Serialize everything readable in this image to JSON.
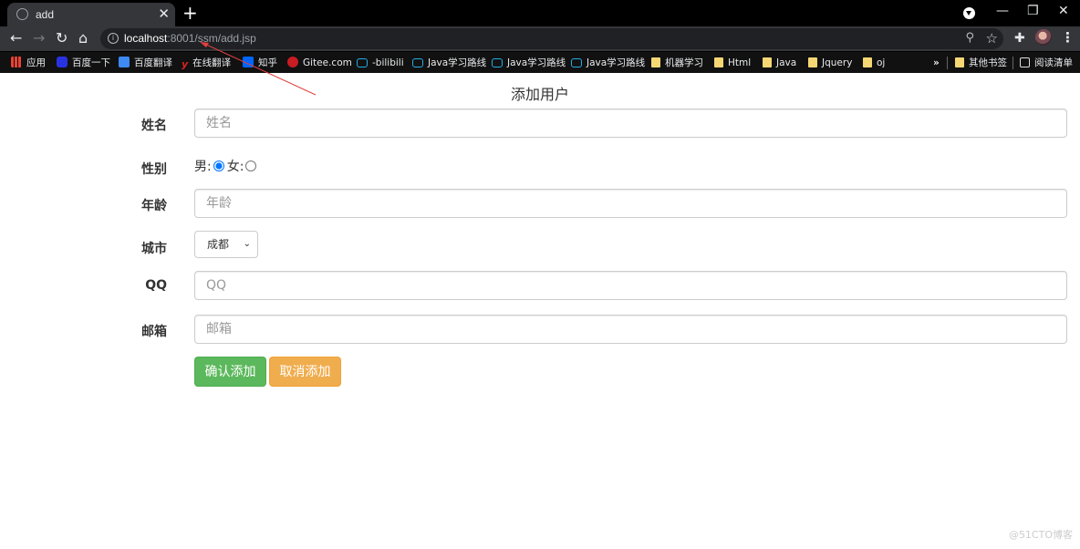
{
  "browser": {
    "tab_title": "add",
    "url_host": "localhost",
    "url_path": ":8001/ssm/add.jsp",
    "bookmarks": [
      "应用",
      "百度一下",
      "百度翻译",
      "在线翻译",
      "知乎",
      "Gitee.com",
      "-bilibili",
      "Java学习路线",
      "Java学习路线",
      "Java学习路线",
      "机器学习",
      "Html",
      "Java",
      "Jquery",
      "oj"
    ],
    "overflow": "»",
    "other_bookmarks": "其他书签",
    "reading_list": "阅读清单"
  },
  "page": {
    "title": "添加用户",
    "name_label": "姓名",
    "name_placeholder": "姓名",
    "gender_label": "性别",
    "male_label": "男:",
    "female_label": "女:",
    "gender_selected": "男",
    "age_label": "年龄",
    "age_placeholder": "年龄",
    "city_label": "城市",
    "city_value": "成都",
    "qq_label": "QQ",
    "qq_placeholder": "QQ",
    "email_label": "邮箱",
    "email_placeholder": "邮箱",
    "confirm_button": "确认添加",
    "cancel_button": "取消添加"
  },
  "watermark": "@51CTO博客",
  "colors": {
    "confirm": "#5cb85c",
    "cancel": "#f0ad4e",
    "annotation_arrow": "#e04040"
  }
}
